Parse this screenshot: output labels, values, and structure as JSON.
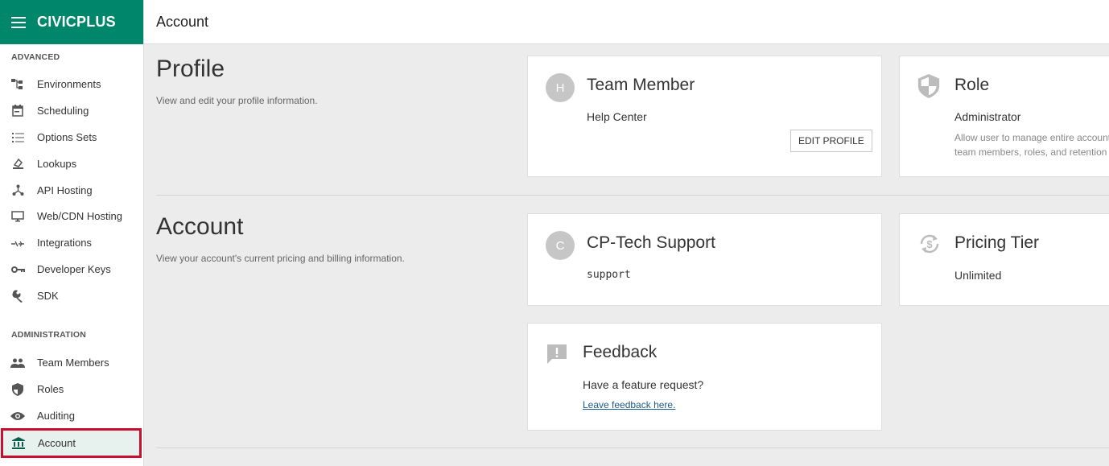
{
  "app": {
    "brand": "CIVICPLUS",
    "header_title": "Account"
  },
  "sidebar": {
    "sections": [
      {
        "title": "ADVANCED"
      },
      {
        "title": "ADMINISTRATION"
      }
    ],
    "items": [
      {
        "label": "Environments",
        "icon": "environments-icon"
      },
      {
        "label": "Scheduling",
        "icon": "calendar-icon"
      },
      {
        "label": "Options Sets",
        "icon": "list-icon"
      },
      {
        "label": "Lookups",
        "icon": "lookups-icon"
      },
      {
        "label": "API Hosting",
        "icon": "api-hosting-icon"
      },
      {
        "label": "Web/CDN Hosting",
        "icon": "monitor-icon"
      },
      {
        "label": "Integrations",
        "icon": "integrations-icon"
      },
      {
        "label": "Developer Keys",
        "icon": "key-icon"
      },
      {
        "label": "SDK",
        "icon": "wrench-icon"
      },
      {
        "label": "Team Members",
        "icon": "people-icon"
      },
      {
        "label": "Roles",
        "icon": "shield-icon"
      },
      {
        "label": "Auditing",
        "icon": "eye-icon"
      },
      {
        "label": "Account",
        "icon": "bank-icon",
        "active": true
      }
    ]
  },
  "profile": {
    "title": "Profile",
    "description": "View and edit your profile information.",
    "member_card": {
      "avatar": "H",
      "title": "Team Member",
      "name": "Help Center",
      "button": "EDIT PROFILE"
    },
    "role_card": {
      "title": "Role",
      "role": "Administrator",
      "desc_line1": "Allow user to manage entire account",
      "desc_line2": "team members, roles, and retention"
    }
  },
  "account": {
    "title": "Account",
    "description": "View your account's current pricing and billing information.",
    "support_card": {
      "avatar": "C",
      "title": "CP-Tech Support",
      "value": "support"
    },
    "pricing_card": {
      "title": "Pricing Tier",
      "value": "Unlimited"
    },
    "feedback_card": {
      "title": "Feedback",
      "question": "Have a feature request?",
      "link": "Leave feedback here."
    }
  },
  "colors": {
    "brand": "#00866a",
    "active_bg": "#e7f1ee",
    "highlight": "#c8102e"
  }
}
